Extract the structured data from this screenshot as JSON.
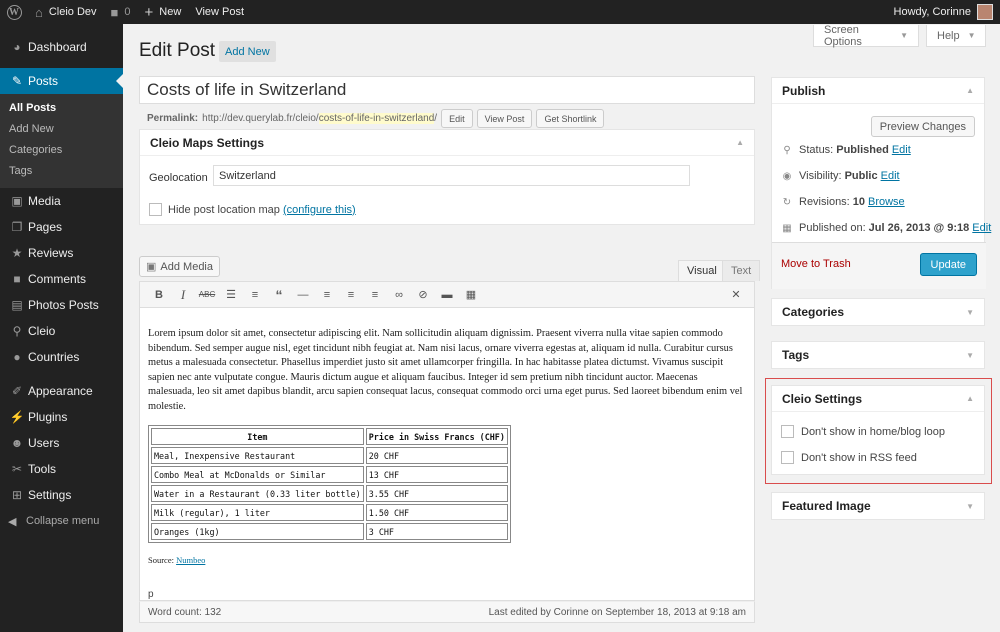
{
  "admin_bar": {
    "site_name": "Cleio Dev",
    "comments_count": "0",
    "new_label": "New",
    "view_post": "View Post",
    "howdy": "Howdy, Corinne"
  },
  "menu": {
    "items": [
      {
        "label": "Dashboard",
        "icon": "dashboard-icon"
      },
      {
        "label": "Posts",
        "icon": "pin-icon"
      },
      {
        "label": "Media",
        "icon": "media-icon"
      },
      {
        "label": "Pages",
        "icon": "pages-icon"
      },
      {
        "label": "Reviews",
        "icon": "star-icon"
      },
      {
        "label": "Comments",
        "icon": "comments-icon"
      },
      {
        "label": "Photos Posts",
        "icon": "photos-icon"
      },
      {
        "label": "Cleio",
        "icon": "location-icon"
      },
      {
        "label": "Countries",
        "icon": "globe-icon"
      },
      {
        "label": "Appearance",
        "icon": "brush-icon"
      },
      {
        "label": "Plugins",
        "icon": "plugin-icon"
      },
      {
        "label": "Users",
        "icon": "users-icon"
      },
      {
        "label": "Tools",
        "icon": "wrench-icon"
      },
      {
        "label": "Settings",
        "icon": "settings-icon"
      }
    ],
    "posts_sub": [
      "All Posts",
      "Add New",
      "Categories",
      "Tags"
    ],
    "collapse": "Collapse menu"
  },
  "screen_options": "Screen Options",
  "help": "Help",
  "page_title": "Edit Post",
  "add_new": "Add New",
  "post_title": "Costs of life in Switzerland",
  "permalink": {
    "label": "Permalink:",
    "base": "http://dev.querylab.fr/cleio/",
    "slug": "costs-of-life-in-switzerland",
    "trail": "/",
    "edit": "Edit",
    "view": "View Post",
    "shortlink": "Get Shortlink"
  },
  "maps_box": {
    "title": "Cleio Maps Settings",
    "geo_label": "Geolocation",
    "geo_value": "Switzerland",
    "hide_label": "Hide post location map",
    "configure": "(configure this)"
  },
  "add_media": "Add Media",
  "tabs": {
    "visual": "Visual",
    "text": "Text"
  },
  "content": {
    "paragraph": "Lorem ipsum dolor sit amet, consectetur adipiscing elit. Nam sollicitudin aliquam dignissim. Praesent viverra nulla vitae sapien commodo bibendum. Sed semper augue nisl, eget tincidunt nibh feugiat at. Nam nisi lacus, ornare viverra egestas at, aliquam id nulla. Curabitur cursus metus a malesuada consectetur. Phasellus imperdiet justo sit amet ullamcorper fringilla. In hac habitasse platea dictumst. Vivamus suscipit sapien nec ante vulputate congue. Mauris dictum augue et aliquam faucibus. Integer id sem pretium nibh tincidunt auctor. Maecenas malesuada, leo sit amet dapibus blandit, arcu sapien consequat lacus, consequat commodo orci urna eget purus. Sed laoreet bibendum enim vel molestie.",
    "table_headers": [
      "Item",
      "Price in Swiss Francs (CHF)"
    ],
    "table_rows": [
      [
        "Meal, Inexpensive Restaurant",
        "20 CHF"
      ],
      [
        "Combo Meal at McDonalds or Similar",
        "13 CHF"
      ],
      [
        "Water in a Restaurant (0.33 liter bottle)",
        "3.55 CHF"
      ],
      [
        "Milk (regular), 1 liter",
        "1.50 CHF"
      ],
      [
        "Oranges (1kg)",
        "3 CHF"
      ]
    ],
    "source_label": "Source:",
    "source_link": "Numbeo",
    "path": "p"
  },
  "status_bar": {
    "word_count": "Word count: 132",
    "last_edited": "Last edited by Corinne on September 18, 2013 at 9:18 am"
  },
  "publish": {
    "title": "Publish",
    "preview": "Preview Changes",
    "status_label": "Status:",
    "status_value": "Published",
    "visibility_label": "Visibility:",
    "visibility_value": "Public",
    "revisions_label": "Revisions:",
    "revisions_value": "10",
    "browse": "Browse",
    "published_label": "Published on:",
    "published_value": "Jul 26, 2013 @ 9:18",
    "edit": "Edit",
    "trash": "Move to Trash",
    "update": "Update"
  },
  "categories_title": "Categories",
  "tags_title": "Tags",
  "cleio_settings": {
    "title": "Cleio Settings",
    "opt1": "Don't show in home/blog loop",
    "opt2": "Don't show in RSS feed"
  },
  "featured_title": "Featured Image",
  "colors": {
    "admin_bar": "#222222",
    "menu_active": "#0074a2",
    "update_button": "#2ea2cc",
    "highlight_frame": "#d94c4c",
    "trash": "#aa0000"
  }
}
